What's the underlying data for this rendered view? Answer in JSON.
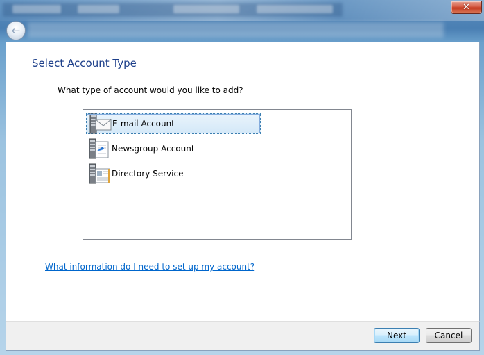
{
  "window": {
    "close_glyph": "✕",
    "back_glyph": "←"
  },
  "page": {
    "title": "Select Account Type",
    "question": "What type of account would you like to add?",
    "help_link": "What information do I need to set up my account?"
  },
  "account_types": [
    {
      "label": "E-mail Account",
      "icon": "email-server-icon",
      "selected": true
    },
    {
      "label": "Newsgroup Account",
      "icon": "newsgroup-server-icon",
      "selected": false
    },
    {
      "label": "Directory Service",
      "icon": "directory-server-icon",
      "selected": false
    }
  ],
  "buttons": {
    "next": "Next",
    "cancel": "Cancel"
  },
  "colors": {
    "title": "#1d3f8a",
    "link": "#0066cc",
    "selection": "#d3e8f8",
    "close_button": "#c43a20"
  }
}
